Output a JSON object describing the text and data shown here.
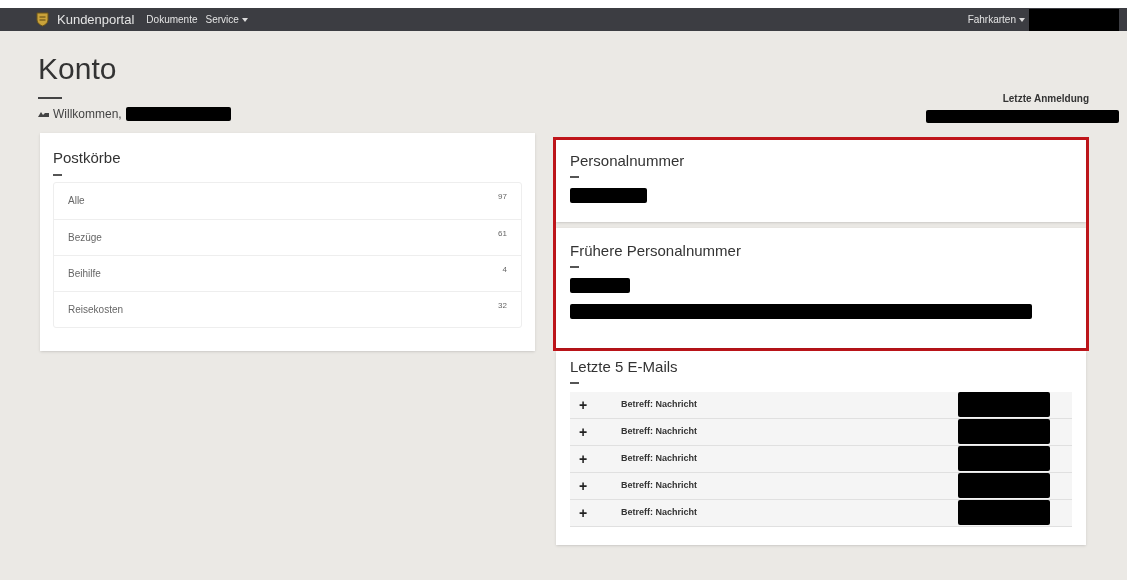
{
  "navbar": {
    "brand": "Kundenportal",
    "links": [
      {
        "label": "Dokumente",
        "dropdown": false
      },
      {
        "label": "Service",
        "dropdown": true
      }
    ],
    "right_menu": {
      "label": "Fahrkarten",
      "dropdown": true
    }
  },
  "page": {
    "title": "Konto",
    "welcome": "Willkommen,",
    "last_login_label": "Letzte Anmeldung"
  },
  "mailboxes": {
    "title": "Postkörbe",
    "items": [
      {
        "label": "Alle",
        "count": "97"
      },
      {
        "label": "Bezüge",
        "count": "61"
      },
      {
        "label": "Beihilfe",
        "count": "4"
      },
      {
        "label": "Reisekosten",
        "count": "32"
      }
    ]
  },
  "personnel_number": {
    "title": "Personalnummer"
  },
  "former_personnel_number": {
    "title": "Frühere Personalnummer"
  },
  "emails": {
    "title": "Letzte 5 E-Mails",
    "rows": [
      {
        "expand": "+",
        "subject": "Betreff: Nachricht"
      },
      {
        "expand": "+",
        "subject": "Betreff: Nachricht"
      },
      {
        "expand": "+",
        "subject": "Betreff: Nachricht"
      },
      {
        "expand": "+",
        "subject": "Betreff: Nachricht"
      },
      {
        "expand": "+",
        "subject": "Betreff: Nachricht"
      }
    ]
  }
}
